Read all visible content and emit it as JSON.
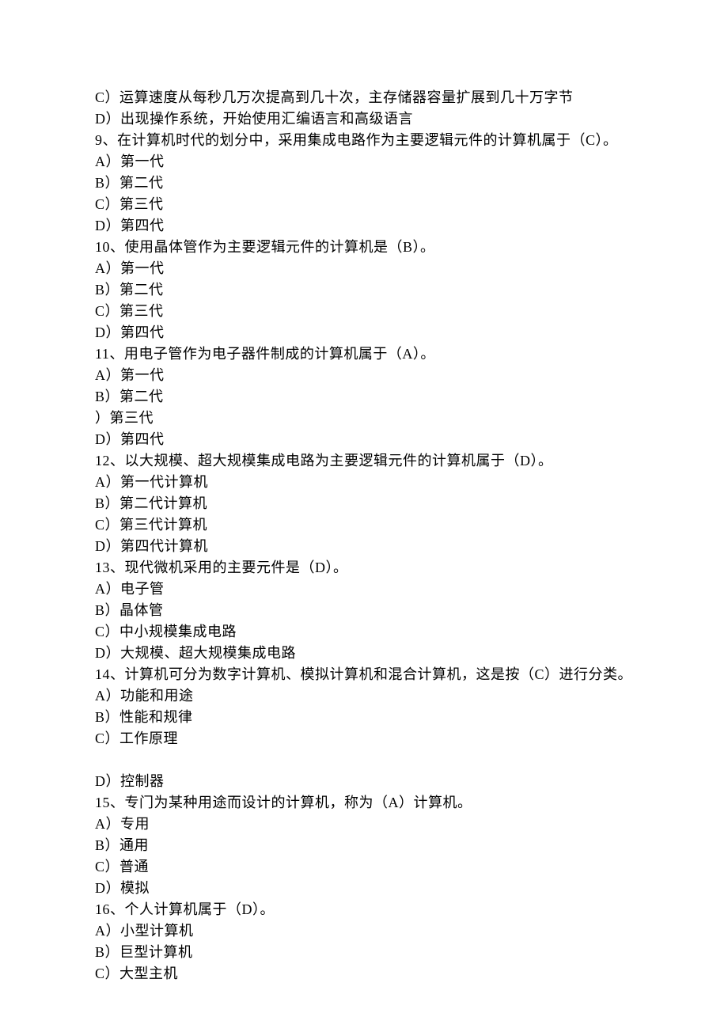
{
  "lines": [
    "C）运算速度从每秒几万次提高到几十次，主存储器容量扩展到几十万字节",
    "D）出现操作系统，开始使用汇编语言和高级语言",
    "9、在计算机时代的划分中，采用集成电路作为主要逻辑元件的计算机属于（C）。",
    "A）第一代",
    "B）第二代",
    "C）第三代",
    "D）第四代",
    "10、使用晶体管作为主要逻辑元件的计算机是（B）。",
    "A）第一代",
    "B）第二代",
    "C）第三代",
    "D）第四代",
    "11、用电子管作为电子器件制成的计算机属于（A）。",
    "A）第一代",
    "B）第二代",
    "）第三代",
    "D）第四代",
    "12、以大规模、超大规模集成电路为主要逻辑元件的计算机属于（D）。",
    "A）第一代计算机",
    "B）第二代计算机",
    "C）第三代计算机",
    "D）第四代计算机",
    "13、现代微机采用的主要元件是（D）。",
    "A）电子管",
    "B）晶体管",
    "C）中小规模集成电路",
    "D）大规模、超大规模集成电路",
    "14、计算机可分为数字计算机、模拟计算机和混合计算机，这是按（C）进行分类。",
    "A）功能和用途",
    "B）性能和规律",
    "C）工作原理",
    "",
    "D）控制器",
    "15、专门为某种用途而设计的计算机，称为（A）计算机。",
    "A）专用",
    "B）通用",
    "C）普通",
    "D）模拟",
    "16、个人计算机属于（D）。",
    "A）小型计算机",
    "B）巨型计算机",
    "C）大型主机"
  ]
}
